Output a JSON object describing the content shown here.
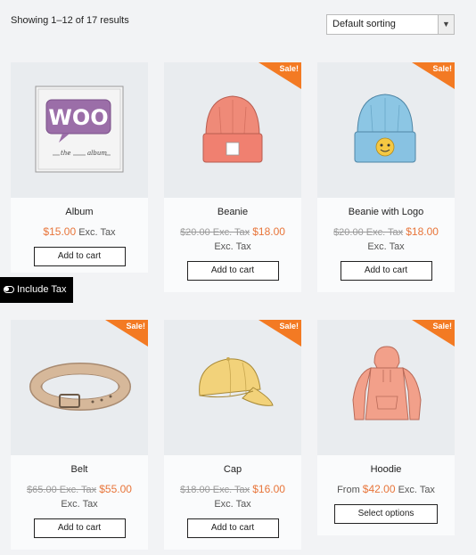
{
  "results": {
    "text": "Showing 1–12 of 17 results"
  },
  "sorting": {
    "selected": "Default sorting"
  },
  "tax_toggle": {
    "label": "Include Tax"
  },
  "sale_badge": "Sale!",
  "products": [
    {
      "name": "Album",
      "price": "$15.00",
      "suffix": "Exc. Tax",
      "button": "Add to cart"
    },
    {
      "name": "Beanie",
      "old_price": "$20.00",
      "old_suffix": "Exc. Tax",
      "new_price": "$18.00",
      "suffix": "Exc. Tax",
      "button": "Add to cart"
    },
    {
      "name": "Beanie with Logo",
      "old_price": "$20.00",
      "old_suffix": "Exc. Tax",
      "new_price": "$18.00",
      "suffix": "Exc. Tax",
      "button": "Add to cart"
    },
    {
      "name": "Belt",
      "old_price": "$65.00",
      "old_suffix": "Exc. Tax",
      "new_price": "$55.00",
      "suffix": "Exc. Tax",
      "button": "Add to cart"
    },
    {
      "name": "Cap",
      "old_price": "$18.00",
      "old_suffix": "Exc. Tax",
      "new_price": "$16.00",
      "suffix": "Exc. Tax",
      "button": "Add to cart"
    },
    {
      "name": "Hoodie",
      "prefix": "From",
      "price": "$42.00",
      "suffix": "Exc. Tax",
      "button": "Select options"
    }
  ],
  "album_art": {
    "logo": "WOO",
    "left_caption": "the",
    "right_caption": "album"
  }
}
